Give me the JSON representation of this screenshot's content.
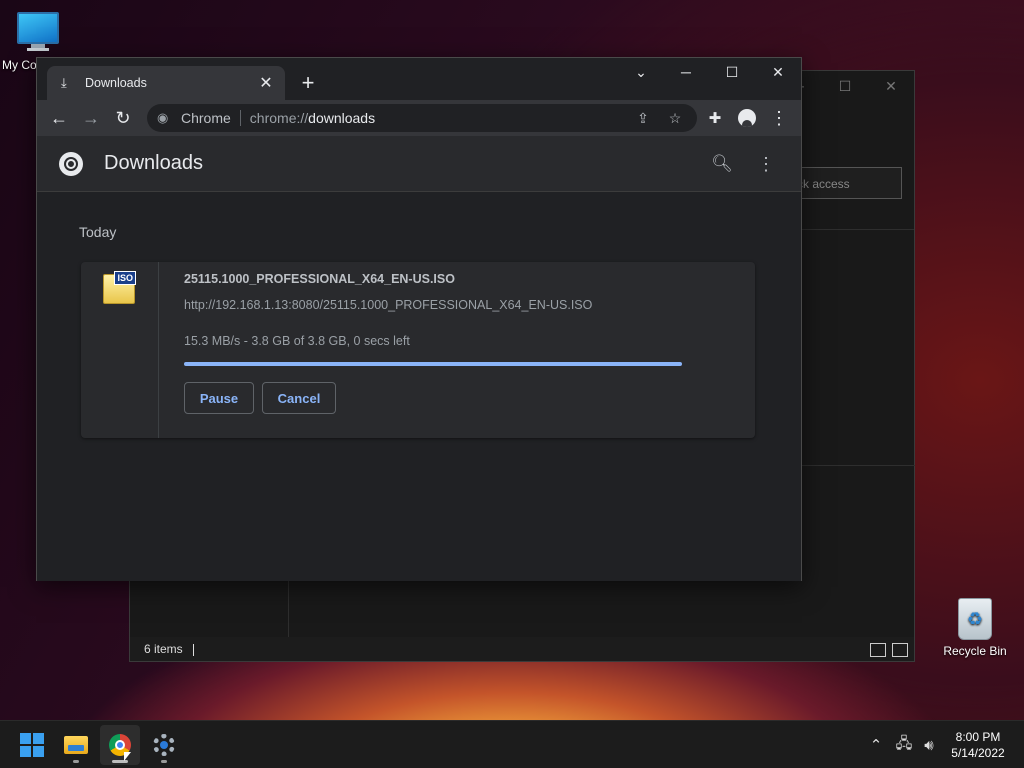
{
  "desktop": {
    "my_computer_label": "My Co",
    "recycle_bin_label": "Recycle Bin"
  },
  "explorer": {
    "search_placeholder": "ck access",
    "status_items": "6 items"
  },
  "chrome": {
    "tab_title": "Downloads",
    "omnibox_scheme": "Chrome",
    "omnibox_url_prefix": "chrome://",
    "omnibox_url_host": "downloads",
    "page_title": "Downloads",
    "day_label": "Today",
    "download": {
      "file_name": "25115.1000_PROFESSIONAL_X64_EN-US.ISO",
      "url": "http://192.168.1.13:8080/25115.1000_PROFESSIONAL_X64_EN-US.ISO",
      "status": "15.3 MB/s - 3.8 GB of 3.8 GB, 0 secs left",
      "file_badge": "ISO",
      "progress_fraction": 1.0,
      "pause_label": "Pause",
      "cancel_label": "Cancel"
    }
  },
  "taskbar": {
    "time": "8:00 PM",
    "date": "5/14/2022"
  },
  "colors": {
    "accent": "#8ab4f8",
    "chrome_bg": "#202124",
    "toolbar_bg": "#35363a"
  }
}
